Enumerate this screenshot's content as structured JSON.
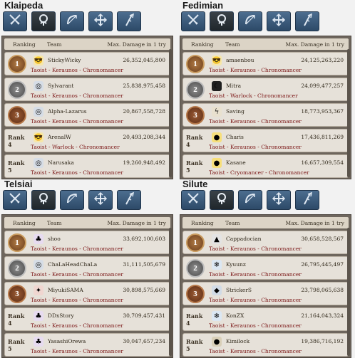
{
  "panels": [
    {
      "server": "Klaipeda",
      "header": {
        "ranking": "Ranking",
        "team": "Team",
        "damage": "Max. Damage in 1 try"
      },
      "rows": [
        {
          "rank": "1",
          "rank_style": "gold",
          "team": "StickyWicky",
          "damage": "26,352,045,800",
          "classes": "Taoist - Keraunos - Chronomancer",
          "avatar_icon": "sunglasses-icon"
        },
        {
          "rank": "2",
          "rank_style": "silver",
          "team": "Sylvarant",
          "damage": "25,838,975,458",
          "classes": "Taoist - Keraunos - Chronomancer",
          "avatar_icon": "swirl-icon"
        },
        {
          "rank": "3",
          "rank_style": "bronze",
          "team": "Alpha-Lazarus",
          "damage": "20,867,558,728",
          "classes": "Taoist - Keraunos - Chronomancer",
          "avatar_icon": "swirl-icon"
        },
        {
          "rank": "Rank 4",
          "rank_style": "text",
          "team": "ArenalW",
          "damage": "20,493,208,344",
          "classes": "Taoist - Warlock - Chronomancer",
          "avatar_icon": "sunglasses-icon"
        },
        {
          "rank": "Rank 5",
          "rank_style": "text",
          "team": "Narusaka",
          "damage": "19,260,948,492",
          "classes": "Taoist - Keraunos - Chronomancer",
          "avatar_icon": "swirl-icon"
        }
      ]
    },
    {
      "server": "Fedimian",
      "header": {
        "ranking": "Ranking",
        "team": "Team",
        "damage": "Max. Damage in 1 try"
      },
      "rows": [
        {
          "rank": "1",
          "rank_style": "gold",
          "team": "amaenbou",
          "damage": "24,125,263,220",
          "classes": "Taoist - Keraunos - Chronomancer",
          "avatar_icon": "sunglasses-icon"
        },
        {
          "rank": "2",
          "rank_style": "silver",
          "team": "Mitra",
          "damage": "24,099,477,257",
          "classes": "Taoist - Warlock - Chronomancer",
          "avatar_icon": "moon-icon"
        },
        {
          "rank": "3",
          "rank_style": "bronze",
          "team": "Saving",
          "damage": "18,773,953,367",
          "classes": "Taoist - Keraunos - Chronomancer",
          "avatar_icon": "feather-icon"
        },
        {
          "rank": "Rank 4",
          "rank_style": "text",
          "team": "Charis",
          "damage": "17,436,811,269",
          "classes": "Taoist - Keraunos - Chronomancer",
          "avatar_icon": "chick-icon"
        },
        {
          "rank": "Rank 5",
          "rank_style": "text",
          "team": "Kasane",
          "damage": "16,657,309,554",
          "classes": "Taoist - Cryomancer - Chronomancer",
          "avatar_icon": "chick-icon"
        }
      ]
    },
    {
      "server": "Telsiai",
      "header": {
        "ranking": "Ranking",
        "team": "Team",
        "damage": "Max. Damage in 1 try"
      },
      "rows": [
        {
          "rank": "1",
          "rank_style": "gold",
          "team": "shoo",
          "damage": "33,692,100,603",
          "classes": "Taoist - Keraunos - Chronomancer",
          "avatar_icon": "purple-creature-icon"
        },
        {
          "rank": "2",
          "rank_style": "silver",
          "team": "ChaLaHeadChaLa",
          "damage": "31,111,505,679",
          "classes": "Taoist - Keraunos - Chronomancer",
          "avatar_icon": "swirl-icon"
        },
        {
          "rank": "3",
          "rank_style": "bronze",
          "team": "MiyukiSAMA",
          "damage": "30,898,575,669",
          "classes": "Taoist - Keraunos - Chronomancer",
          "avatar_icon": "red-wing-icon"
        },
        {
          "rank": "Rank 4",
          "rank_style": "text",
          "team": "DDxStory",
          "damage": "30,709,457,431",
          "classes": "Taoist - Keraunos - Chronomancer",
          "avatar_icon": "purple-creature-icon"
        },
        {
          "rank": "Rank 5",
          "rank_style": "text",
          "team": "YasashiOrewa",
          "damage": "30,047,657,234",
          "classes": "Taoist - Keraunos - Chronomancer",
          "avatar_icon": "purple-creature-icon"
        }
      ]
    },
    {
      "server": "Silute",
      "header": {
        "ranking": "Ranking",
        "team": "Team",
        "damage": "Max. Damage in 1 try"
      },
      "rows": [
        {
          "rank": "1",
          "rank_style": "gold",
          "team": "Cappadocian",
          "damage": "30,658,528,567",
          "classes": "Taoist - Keraunos - Chronomancer",
          "avatar_icon": "hat-icon"
        },
        {
          "rank": "2",
          "rank_style": "silver",
          "team": "Kyuunz",
          "damage": "26,795,445,497",
          "classes": "Taoist - Keraunos - Chronomancer",
          "avatar_icon": "snowflake-icon"
        },
        {
          "rank": "3",
          "rank_style": "bronze",
          "team": "StrickerS",
          "damage": "23,798,065,638",
          "classes": "Taoist - Keraunos - Chronomancer",
          "avatar_icon": "shield-icon"
        },
        {
          "rank": "Rank 4",
          "rank_style": "text",
          "team": "KonZX",
          "damage": "21,164,043,324",
          "classes": "Taoist - Keraunos - Chronomancer",
          "avatar_icon": "snowflake-icon"
        },
        {
          "rank": "Rank 5",
          "rank_style": "text",
          "team": "Kimilock",
          "damage": "19,386,716,192",
          "classes": "Taoist - Keraunos - Chronomancer",
          "avatar_icon": "helmet-icon"
        }
      ]
    }
  ],
  "tabs": [
    "swords-icon",
    "class-emblem-icon",
    "bow-icon",
    "cross-arrows-icon",
    "staff-icon"
  ],
  "active_tab": 1,
  "colors": {
    "class_text": "#7a1414",
    "tab_blue": "#3d5c7c",
    "board_bg": "#6e665d",
    "row_bg": "#e6e1d9"
  }
}
